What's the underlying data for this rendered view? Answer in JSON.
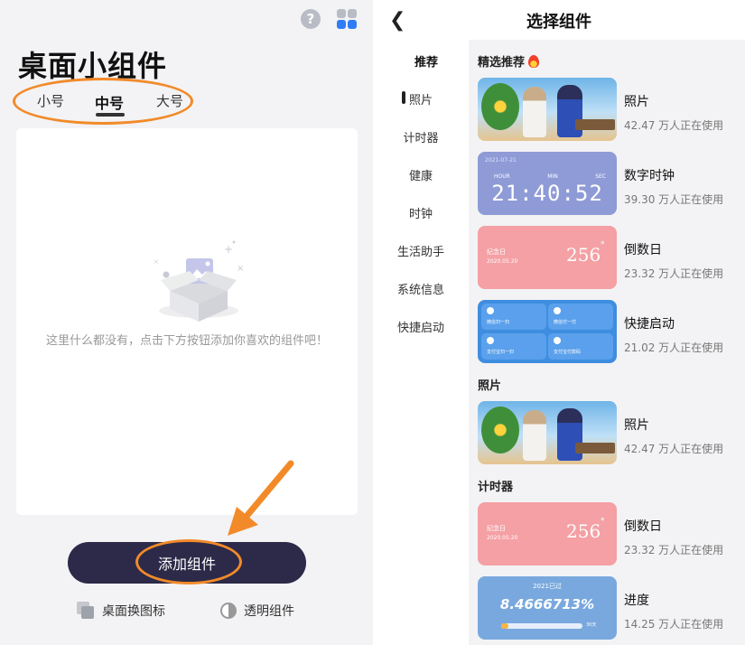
{
  "left": {
    "title": "桌面小组件",
    "size_tabs": [
      "小号",
      "中号",
      "大号"
    ],
    "active_tab": "中号",
    "empty_text": "这里什么都没有，点击下方按钮添加你喜欢的组件吧！",
    "add_button": "添加组件",
    "bottom_links": [
      "桌面换图标",
      "透明组件"
    ],
    "top_icons": [
      "help-icon",
      "widget-grid-icon"
    ]
  },
  "right": {
    "nav_title": "选择组件",
    "side_menu": [
      "推荐",
      "照片",
      "计时器",
      "健康",
      "时钟",
      "生活助手",
      "系统信息",
      "快捷启动"
    ],
    "active_menu": "推荐",
    "sections": [
      {
        "title": "精选推荐",
        "widgets": [
          {
            "name": "照片",
            "users": "42.47 万人正在使用",
            "type": "photo"
          },
          {
            "name": "数字时钟",
            "users": "39.30 万人正在使用",
            "type": "clock",
            "date": "2021-07-21",
            "labels": [
              "HOUR",
              "MIN",
              "SEC"
            ],
            "time": "21:40:52"
          },
          {
            "name": "倒数日",
            "users": "23.32 万人正在使用",
            "type": "countdown",
            "label": "纪念日",
            "date": "2020.05.20",
            "days": "256"
          },
          {
            "name": "快捷启动",
            "users": "21.02 万人正在使用",
            "type": "quick",
            "items": [
              "微信扫一扫",
              "微信付一付",
              "支付宝扫一扫",
              "支付宝付款码"
            ]
          }
        ]
      },
      {
        "title": "照片",
        "widgets": [
          {
            "name": "照片",
            "users": "42.47 万人正在使用",
            "type": "photo"
          }
        ]
      },
      {
        "title": "计时器",
        "widgets": [
          {
            "name": "倒数日",
            "users": "23.32 万人正在使用",
            "type": "countdown",
            "label": "纪念日",
            "date": "2020.05.20",
            "days": "256"
          },
          {
            "name": "进度",
            "users": "14.25 万人正在使用",
            "type": "progress",
            "header": "2021已过",
            "value": "8.4666713%",
            "progress": 0.084666713,
            "remaining": "30天"
          }
        ]
      }
    ]
  },
  "colors": {
    "accent_orange": "#f28a2a",
    "button_dark": "#2c2a48",
    "clock_bg": "#8e9bd6",
    "countdown_bg": "#f4a0a4",
    "quick_bg": "#3e8de0",
    "progress_bg": "#79a8de"
  }
}
